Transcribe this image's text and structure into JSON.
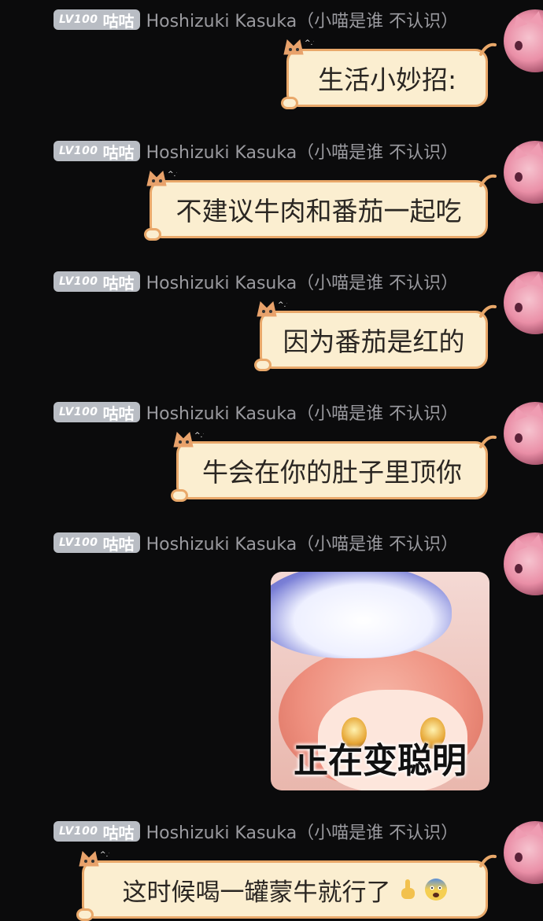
{
  "sender": {
    "level_badge": "LV100",
    "title": "咕咕",
    "nickname": "Hoshizuki Kasuka（小喵是谁 不认识）"
  },
  "messages": [
    {
      "type": "text",
      "text": "生活小妙招:"
    },
    {
      "type": "text",
      "text": "不建议牛肉和番茄一起吃"
    },
    {
      "type": "text",
      "text": "因为番茄是红的"
    },
    {
      "type": "text",
      "text": "牛会在你的肚子里顶你"
    },
    {
      "type": "sticker",
      "caption": "正在变聪明"
    },
    {
      "type": "text",
      "text": "这时候喝一罐蒙牛就行了",
      "emojis": [
        "pointing-up-icon",
        "fearful-face-icon"
      ]
    }
  ],
  "colors": {
    "background": "#0b0b0c",
    "bubble_fill": "#fbeed0",
    "bubble_border": "#e9a86a",
    "badge": "#b9bdc4",
    "nickname": "#9a9a9f"
  }
}
